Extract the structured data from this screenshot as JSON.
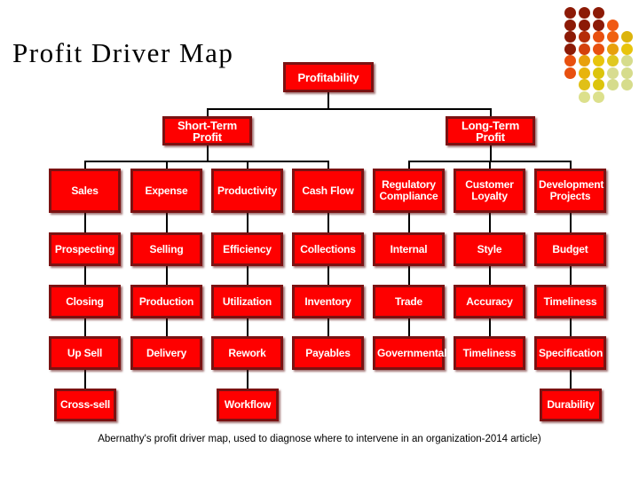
{
  "slide": {
    "title": "Profit Driver Map",
    "caption": "Abernathy's profit driver map, used to diagnose where to intervene in an organization-2014 article)",
    "background": "#ffffff"
  },
  "theme": {
    "node_fill": "#fe0000",
    "node_border": "#7b1212",
    "node_text": "#ffffff",
    "connector": "#000000",
    "title_color": "#000000"
  },
  "decor_dots": {
    "name": "decorative-dot-grid",
    "rows": [
      [
        "#8c1a06",
        "#8c1a06",
        "#8c1a06"
      ],
      [
        "#8c1a06",
        "#8c1a06",
        "#8c1a06",
        "#f05a14"
      ],
      [
        "#8c1a06",
        "#b52d08",
        "#e8500f",
        "#f0600f",
        "#dcb40c"
      ],
      [
        "#8c1a06",
        "#d4400c",
        "#e8500f",
        "#e8a00c",
        "#e8c40c"
      ],
      [
        "#e8500f",
        "#e8a00c",
        "#e8c40c",
        "#e0c820",
        "#d6dc8c"
      ],
      [
        "#e8500f",
        "#e8b40c",
        "#dcc40c",
        "#d8dc90",
        "#d6dc8c"
      ],
      [
        "#e0c018",
        "#dcc40c",
        "#d6dc8c",
        "#d6dc8c"
      ],
      [
        "#dce08c",
        "#dce08c"
      ]
    ]
  },
  "chart": {
    "type": "tree-diagram",
    "root": "Profitability",
    "levels": [
      {
        "level": 0,
        "nodes": [
          "Profitability"
        ]
      },
      {
        "level": 1,
        "nodes": [
          "Short-Term Profit",
          "Long-Term Profit"
        ]
      },
      {
        "level": 2,
        "nodes": [
          "Sales",
          "Expense",
          "Productivity",
          "Cash Flow",
          "Regulatory Compliance",
          "Customer Loyalty",
          "Development Projects"
        ]
      },
      {
        "level": 3,
        "nodes": [
          "Prospecting",
          "Selling",
          "Efficiency",
          "Collections",
          "Internal",
          "Style",
          "Budget"
        ]
      },
      {
        "level": 4,
        "nodes": [
          "Closing",
          "Production",
          "Utilization",
          "Inventory",
          "Trade",
          "Accuracy",
          "Timeliness"
        ]
      },
      {
        "level": 5,
        "nodes": [
          "Up Sell",
          "Delivery",
          "Rework",
          "Payables",
          "Governmental",
          "Timeliness",
          "Specification"
        ]
      },
      {
        "level": 6,
        "nodes": [
          "Cross-sell",
          "Workflow",
          "Durability"
        ]
      }
    ],
    "nodes": {
      "profitability": "Profitability",
      "short_term_profit": "Short-Term Profit",
      "long_term_profit": "Long-Term Profit",
      "sales": "Sales",
      "expense": "Expense",
      "productivity": "Productivity",
      "cash_flow": "Cash Flow",
      "regulatory_compliance_l1": "Regulatory",
      "regulatory_compliance_l2": "Compliance",
      "customer_loyalty_l1": "Customer",
      "customer_loyalty_l2": "Loyalty",
      "development_projects_l1": "Development",
      "development_projects_l2": "Projects",
      "prospecting": "Prospecting",
      "selling": "Selling",
      "efficiency": "Efficiency",
      "collections": "Collections",
      "internal": "Internal",
      "style": "Style",
      "budget": "Budget",
      "closing": "Closing",
      "production": "Production",
      "utilization": "Utilization",
      "inventory": "Inventory",
      "trade": "Trade",
      "accuracy": "Accuracy",
      "timeliness_r4": "Timeliness",
      "up_sell": "Up Sell",
      "delivery": "Delivery",
      "rework": "Rework",
      "payables": "Payables",
      "governmental": "Governmental",
      "timeliness_r5": "Timeliness",
      "specification": "Specification",
      "cross_sell": "Cross-sell",
      "workflow": "Workflow",
      "durability": "Durability"
    }
  }
}
